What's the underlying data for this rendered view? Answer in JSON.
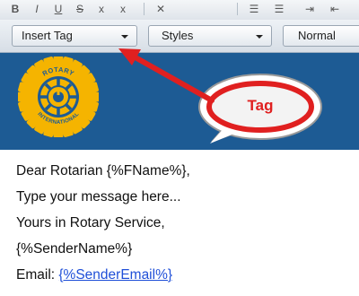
{
  "toolbar": {
    "insert_tag_label": "Insert Tag",
    "styles_label": "Styles",
    "format_label": "Normal"
  },
  "callout": {
    "label": "Tag"
  },
  "logo": {
    "top_text": "ROTARY",
    "bottom_text": "INTERNATIONAL"
  },
  "message": {
    "greeting": "Dear Rotarian {%FName%},",
    "body": "Type your message here...",
    "closing": "Yours in Rotary Service,",
    "sender": "{%SenderName%}",
    "email_label": "Email: ",
    "email_value": "{%SenderEmail%}"
  },
  "colors": {
    "header_bg": "#1d5b94",
    "logo_gold": "#f5b400",
    "callout_red": "#e02020"
  }
}
